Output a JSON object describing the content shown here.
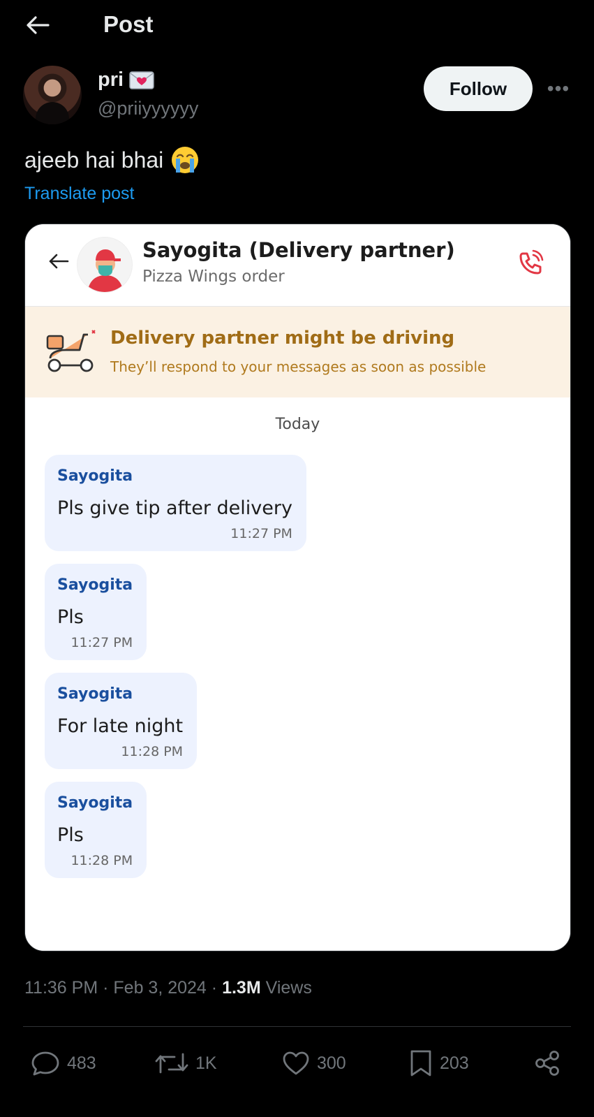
{
  "topbar": {
    "title": "Post"
  },
  "author": {
    "name": "pri",
    "handle": "@priiyyyyyy",
    "follow_label": "Follow",
    "more_label": "•••"
  },
  "post": {
    "text": "ajeeb hai bhai",
    "translate_label": "Translate post"
  },
  "chat": {
    "title": "Sayogita (Delivery partner)",
    "subtitle": "Pizza Wings order",
    "banner_title": "Delivery partner might be driving",
    "banner_subtitle": "They’ll respond to your messages as soon as possible",
    "date_label": "Today",
    "messages": [
      {
        "sender": "Sayogita",
        "text": "Pls give tip after delivery",
        "time": "11:27 PM"
      },
      {
        "sender": "Sayogita",
        "text": "Pls",
        "time": "11:27 PM"
      },
      {
        "sender": "Sayogita",
        "text": "For late night",
        "time": "11:28 PM"
      },
      {
        "sender": "Sayogita",
        "text": "Pls",
        "time": "11:28 PM"
      }
    ]
  },
  "meta": {
    "time": "11:36 PM",
    "date": "Feb 3, 2024",
    "views_count": "1.3M",
    "views_label": "Views",
    "separator": "·"
  },
  "actions": {
    "replies": "483",
    "reposts": "1K",
    "likes": "300",
    "bookmarks": "203"
  },
  "icons": [
    "back-arrow-icon",
    "envelope-heart-icon",
    "crying-face-icon",
    "phone-icon",
    "scooter-icon",
    "reply-icon",
    "repost-icon",
    "like-icon",
    "bookmark-icon",
    "share-icon"
  ],
  "colors": {
    "background": "#000000",
    "accent": "#1d9bf0",
    "muted": "#71767b",
    "bubble": "#edf2fe",
    "sender": "#1a4f9e",
    "banner": "#fbf1e3",
    "call": "#e23744"
  }
}
